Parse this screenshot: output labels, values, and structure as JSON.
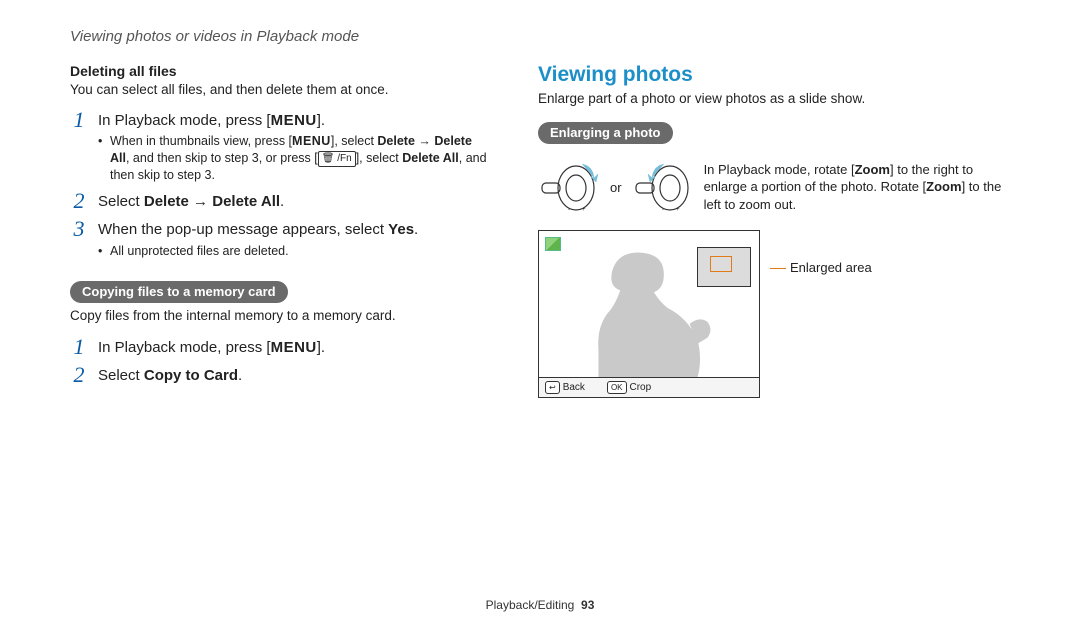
{
  "header": {
    "title": "Viewing photos or videos in Playback mode"
  },
  "left": {
    "delete_all": {
      "heading": "Deleting all files",
      "intro": "You can select all files, and then delete them at once.",
      "step1_pre": "In Playback mode, press [",
      "menu": "MENU",
      "step1_post": "].",
      "step1_detail_a": "When in thumbnails view, press [",
      "step1_detail_b": "], select ",
      "step1_detail_c": "Delete",
      "arrow": " → ",
      "step1_detail_d": "Delete All",
      "step1_detail_e": ", and then skip to step 3, or press [",
      "trash_fn": "🗑 /Fn",
      "step1_detail_f": "], select ",
      "step1_detail_g": "Delete All",
      "step1_detail_h": ", and then skip to step 3.",
      "step2_pre": "Select ",
      "step2_b": "Delete",
      "step2_arrow": " → ",
      "step2_c": "Delete All",
      "step2_post": ".",
      "step3_pre": "When the pop-up message appears, select ",
      "step3_b": "Yes",
      "step3_post": ".",
      "step3_detail": "All unprotected files are deleted."
    },
    "copy": {
      "pill": "Copying files to a memory card",
      "intro": "Copy files from the internal memory to a memory card.",
      "step1_pre": "In Playback mode, press [",
      "menu": "MENU",
      "step1_post": "].",
      "step2_pre": "Select ",
      "step2_b": "Copy to Card",
      "step2_post": "."
    }
  },
  "right": {
    "title": "Viewing photos",
    "intro": "Enlarge part of a photo or view photos as a slide show.",
    "pill": "Enlarging a photo",
    "or": "or",
    "instr_a": "In Playback mode, rotate [",
    "instr_b": "Zoom",
    "instr_c": "] to the right to enlarge a portion of the photo. Rotate [",
    "instr_d": "Zoom",
    "instr_e": "] to the left to zoom out.",
    "enlarged_label": "Enlarged area",
    "footer_back": "Back",
    "footer_crop": "Crop",
    "key_back": "↩",
    "key_ok": "OK"
  },
  "footer": {
    "section": "Playback/Editing",
    "page": "93"
  }
}
